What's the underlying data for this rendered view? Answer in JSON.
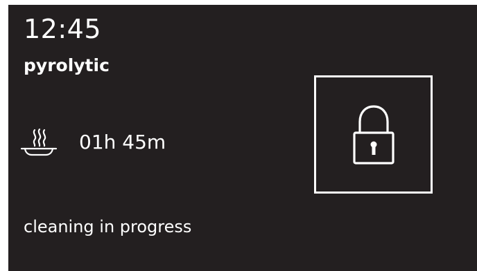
{
  "display": {
    "clock": "12:45",
    "mode": "pyrolytic",
    "duration": "01h 45m",
    "status": "cleaning in progress"
  },
  "icons": {
    "duration_icon": "steaming-dish-icon",
    "lock_icon": "padlock-icon"
  },
  "colors": {
    "background": "#231f20",
    "foreground": "#ffffff"
  }
}
